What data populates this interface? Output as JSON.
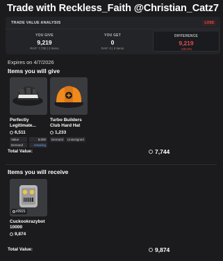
{
  "header": {
    "title": "Trade with Reckless_Faith @Christian_Catz7"
  },
  "analysis": {
    "heading": "TRADE VALUE ANALYSIS",
    "badge": "LOSS",
    "give": {
      "label": "YOU GIVE",
      "value": "9,219",
      "sub": "RAP: 7,730 | 2 items"
    },
    "get": {
      "label": "YOU GET",
      "value": "0",
      "sub": "RAP: 0 | 0 items"
    },
    "difference": {
      "label": "DIFFERENCE",
      "value": "9,219",
      "sub": "-100.0%"
    }
  },
  "expires": "Expires on 4/7/2026",
  "give_section": {
    "title": "Items you will give",
    "items": [
      {
        "name": "Perfectly Legitimate...",
        "value": "6,511",
        "tags": [
          "Value",
          "8,000",
          "Demand",
          "Amazing"
        ]
      },
      {
        "name": "Turbo Builders Club Hard Hat",
        "value": "1,233",
        "tags": [
          "Demand",
          "Unassigned"
        ]
      }
    ],
    "total_label": "Total Value:",
    "total_value": "7,744"
  },
  "receive_section": {
    "title": "Items you will receive",
    "items": [
      {
        "name": "Cuckookrazybot 10000",
        "value": "9,874",
        "serial": "#2021"
      }
    ],
    "total_label": "Total Value:",
    "total_value": "9,874"
  },
  "colors": {
    "background": "#1b1b1d",
    "panel": "#232427",
    "loss": "#e84c4c",
    "amazing": "#6aa6ff"
  }
}
